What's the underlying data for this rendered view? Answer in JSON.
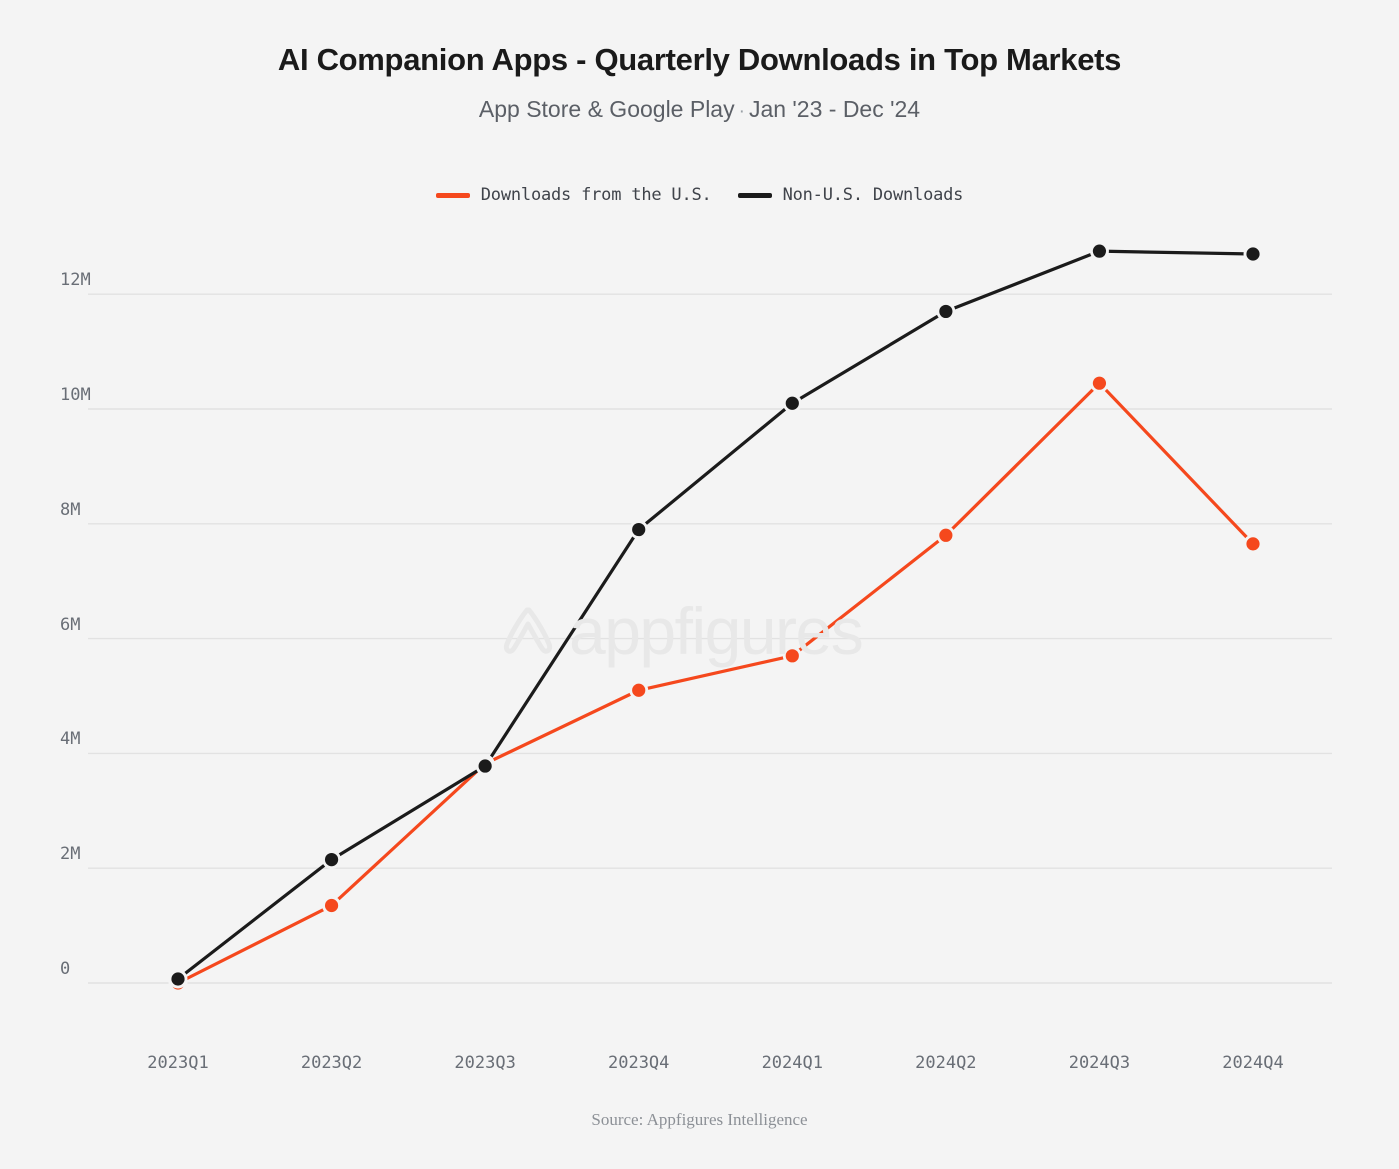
{
  "header": {
    "title": "AI Companion Apps - Quarterly Downloads in Top Markets",
    "subtitle_left": "App Store & Google Play",
    "subtitle_separator": "·",
    "subtitle_right": "Jan '23 - Dec '24"
  },
  "footer": {
    "source": "Source: Appfigures Intelligence"
  },
  "watermark": {
    "text": "appfigures",
    "logo": "appfigures-logo-icon"
  },
  "colors": {
    "us_series": "#f5481d",
    "non_us_series": "#1b1b1b",
    "background": "#f4f4f4",
    "gridline": "#e2e2e2",
    "tick_label": "#696e76",
    "title": "#1a1a1a",
    "subtitle": "#5b5f66",
    "watermark": "#e8e8e8",
    "source": "#8c9096"
  },
  "chart_data": {
    "type": "line",
    "title": "AI Companion Apps - Quarterly Downloads in Top Markets",
    "subtitle": "App Store & Google Play · Jan '23 - Dec '24",
    "xlabel": "",
    "ylabel": "",
    "categories": [
      "2023Q1",
      "2023Q2",
      "2023Q3",
      "2023Q4",
      "2024Q1",
      "2024Q2",
      "2024Q3",
      "2024Q4"
    ],
    "series": [
      {
        "name": "Downloads from the U.S.",
        "color": "#f5481d",
        "values": [
          0.0,
          1.35,
          3.82,
          5.1,
          5.7,
          7.8,
          10.45,
          7.65
        ]
      },
      {
        "name": "Non-U.S. Downloads",
        "color": "#1b1b1b",
        "values": [
          0.07,
          2.15,
          3.78,
          7.9,
          10.1,
          11.7,
          12.75,
          12.7
        ]
      }
    ],
    "ylim": [
      0,
      13.4
    ],
    "yticks": [
      0,
      2,
      4,
      6,
      8,
      10,
      12
    ],
    "ytick_labels": [
      "0",
      "2M",
      "4M",
      "6M",
      "8M",
      "10M",
      "12M"
    ],
    "value_unit": "millions",
    "grid": true,
    "legend_position": "top-center"
  }
}
